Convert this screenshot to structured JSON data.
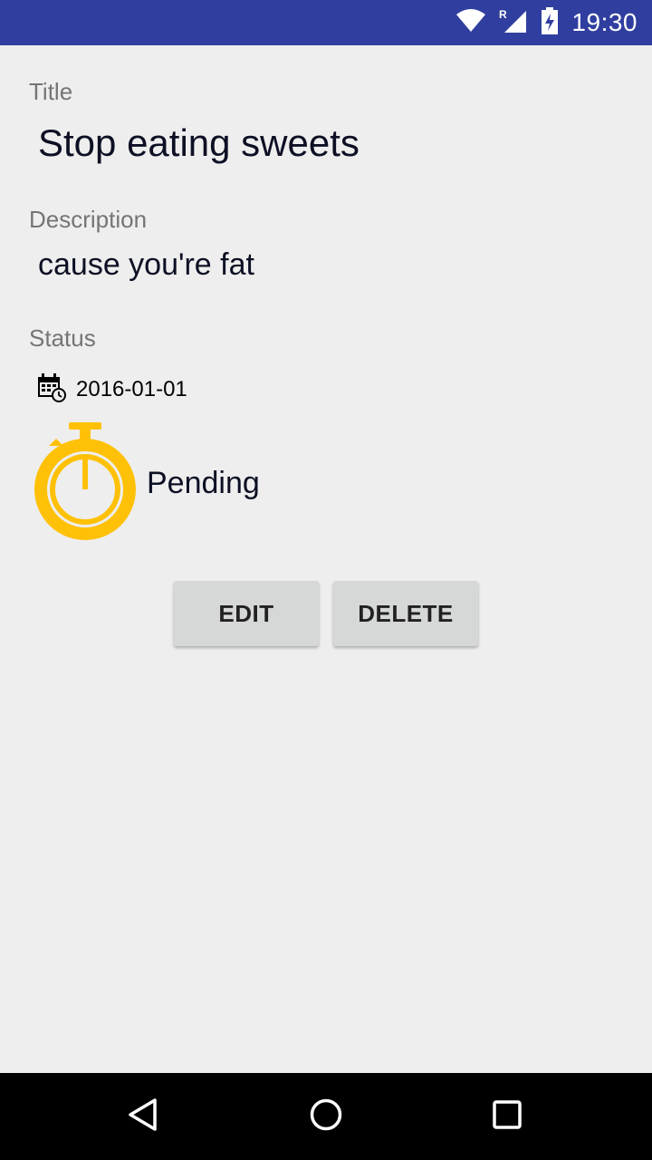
{
  "status_bar": {
    "time": "19:30",
    "icons": [
      "wifi-icon",
      "signal-roaming-icon",
      "battery-charging-icon"
    ],
    "background": "#303f9f"
  },
  "task": {
    "title_label": "Title",
    "title_value": "Stop eating sweets",
    "description_label": "Description",
    "description_value": "cause you're fat",
    "status_label": "Status",
    "date": "2016-01-01",
    "state": "Pending",
    "state_icon": "stopwatch-icon",
    "state_color": "#ffc107"
  },
  "actions": {
    "edit_label": "EDIT",
    "delete_label": "DELETE"
  },
  "nav_bar": {
    "icons": [
      "back-icon",
      "home-icon",
      "recents-icon"
    ]
  }
}
